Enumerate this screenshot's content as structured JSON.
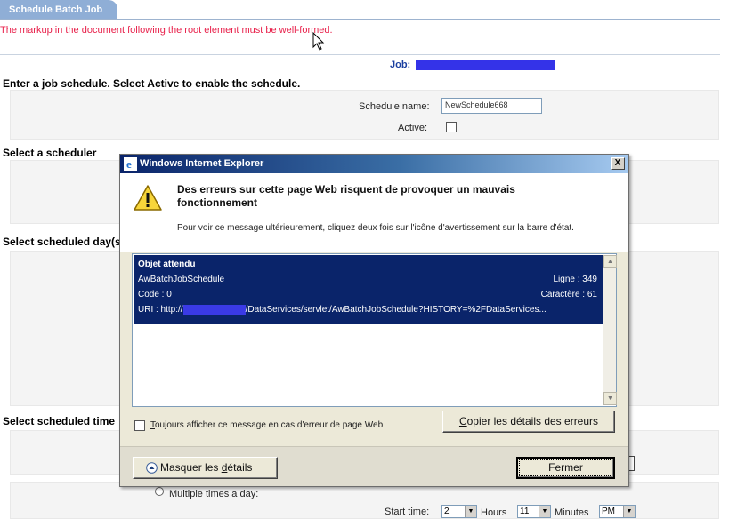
{
  "page": {
    "tab_title": "Schedule Batch Job",
    "error_message": "The markup in the document following the root element must be well-formed.",
    "job_label": "Job:",
    "intro_heading": "Enter a job schedule. Select Active to enable the schedule.",
    "schedule_name_label": "Schedule name:",
    "schedule_name_value": "NewSchedule668",
    "active_label": "Active:",
    "select_scheduler_heading": "Select a scheduler",
    "select_days_heading": "Select scheduled day(s",
    "select_time_heading": "Select scheduled time",
    "multiple_times_label": "Multiple times a day:",
    "start_time_label": "Start time:",
    "hours_value": "2",
    "hours_label": "Hours",
    "minutes_value": "11",
    "minutes_label": "Minutes",
    "ampm_value": "PM"
  },
  "dialog": {
    "title": "Windows Internet Explorer",
    "close_glyph": "X",
    "heading": "Des erreurs sur cette page Web risquent de provoquer un mauvais fonctionnement",
    "subtext": "Pour voir ce message ultérieurement, cliquez deux fois sur l'icône d'avertissement sur la barre d'état.",
    "details": {
      "line1": "Objet attendu",
      "line2": "AwBatchJobSchedule",
      "line2_right": "Ligne : 349",
      "line3": "Code : 0",
      "line3_right": "Caractère : 61",
      "uri_prefix": "URI : http://",
      "uri_suffix": "/DataServices/servlet/AwBatchJobSchedule?HISTORY=%2FDataServices..."
    },
    "always_show_label_first": "T",
    "always_show_label_rest": "oujours afficher ce message en cas d'erreur de page Web",
    "copy_button_first": "C",
    "copy_button_rest": "opier les détails des erreurs",
    "hide_details_first": "Masquer les ",
    "hide_details_underlined": "d",
    "hide_details_rest": "étails",
    "close_button": "Fermer"
  },
  "colors": {
    "error_text": "#e8214b",
    "tab_bg": "#8faed6",
    "selection_bg": "#0a246a",
    "redaction": "#3433e8"
  },
  "icons": {
    "title_icon": "ie-logo-icon",
    "warning": "warning-triangle-icon",
    "cursor": "mouse-pointer-icon"
  }
}
